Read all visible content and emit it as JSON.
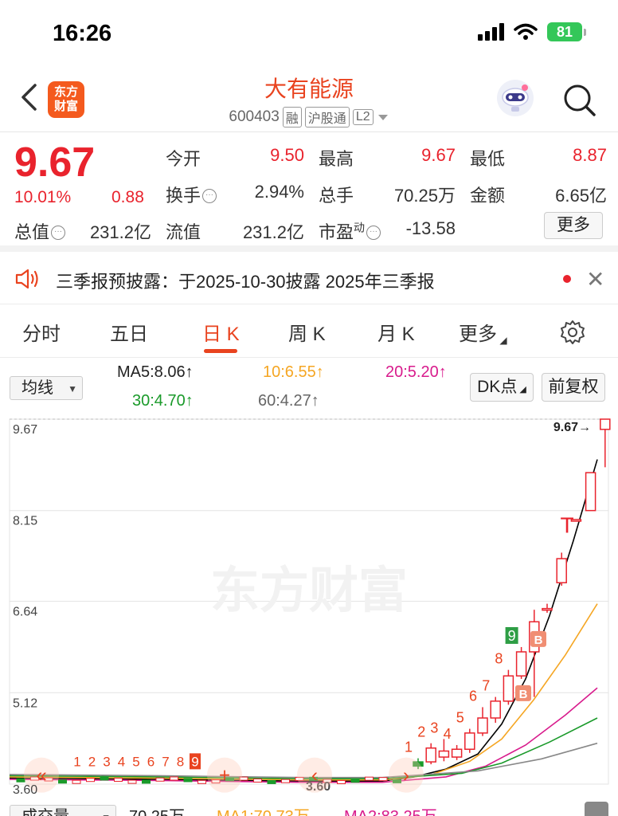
{
  "status": {
    "time": "16:26",
    "battery": "81"
  },
  "header": {
    "logo_line1": "东方",
    "logo_line2": "财富",
    "title": "大有能源",
    "code": "600403",
    "tags": [
      "融",
      "沪股通",
      "L2"
    ]
  },
  "quote": {
    "price": "9.67",
    "change_pct": "10.01%",
    "change_amt": "0.88",
    "fields": {
      "open_label": "今开",
      "open": "9.50",
      "high_label": "最高",
      "high": "9.67",
      "low_label": "最低",
      "low": "8.87",
      "turnover_label": "换手",
      "turnover": "2.94%",
      "volume_label": "总手",
      "volume": "70.25万",
      "amount_label": "金额",
      "amount": "6.65亿",
      "mktcap_label": "总值",
      "mktcap": "231.2亿",
      "float_label": "流值",
      "float": "231.2亿",
      "pe_label": "市盈",
      "pe_sup": "动",
      "pe": "-13.58"
    },
    "more_label": "更多"
  },
  "notice": {
    "text": "三季报预披露：于2025-10-30披露 2025年三季报"
  },
  "tabs": {
    "items": [
      "分时",
      "五日",
      "日 K",
      "周 K",
      "月 K",
      "更多"
    ],
    "active": "日 K"
  },
  "ma_legend": {
    "select": "均线",
    "ma5": "MA5:8.06↑",
    "ma10": "10:6.55↑",
    "ma20": "20:5.20↑",
    "ma30": "30:4.70↑",
    "ma60": "60:4.27↑",
    "dk_label": "DK点",
    "fq_label": "前复权",
    "colors": {
      "ma5": "#000000",
      "ma10": "#f5a623",
      "ma20": "#d81b8c",
      "ma30": "#1a9a2a",
      "ma60": "#888888"
    }
  },
  "chart_data": {
    "type": "candlestick",
    "y_ticks": [
      "9.67",
      "8.15",
      "6.64",
      "5.12",
      "3.60"
    ],
    "ylim": [
      3.6,
      9.67
    ],
    "last_price_label": "9.67→",
    "low_label": "3.60",
    "watermark": "东方财富",
    "signal_labels": [
      "1",
      "2",
      "3",
      "4",
      "5",
      "6",
      "7",
      "8",
      "9"
    ],
    "signal_labels_right": [
      "1",
      "2",
      "3",
      "4",
      "5",
      "6",
      "7",
      "8",
      "9"
    ],
    "b_marks": [
      "B",
      "B"
    ],
    "top_mark": "T",
    "candles": [
      {
        "o": 3.9,
        "c": 3.97,
        "h": 4.03,
        "l": 3.85
      },
      {
        "o": 3.97,
        "c": 4.2,
        "h": 4.28,
        "l": 3.93
      },
      {
        "o": 4.15,
        "c": 4.05,
        "h": 4.35,
        "l": 3.98
      },
      {
        "o": 4.05,
        "c": 4.18,
        "h": 4.25,
        "l": 4.0
      },
      {
        "o": 4.18,
        "c": 4.45,
        "h": 4.52,
        "l": 4.12
      },
      {
        "o": 4.45,
        "c": 4.7,
        "h": 4.88,
        "l": 4.4
      },
      {
        "o": 4.7,
        "c": 4.98,
        "h": 5.05,
        "l": 4.62
      },
      {
        "o": 4.98,
        "c": 5.4,
        "h": 5.5,
        "l": 4.92
      },
      {
        "o": 5.4,
        "c": 5.8,
        "h": 5.88,
        "l": 5.35
      },
      {
        "o": 5.8,
        "c": 6.3,
        "h": 6.5,
        "l": 5.05
      },
      {
        "o": 6.5,
        "c": 6.52,
        "h": 6.6,
        "l": 6.45
      },
      {
        "o": 6.95,
        "c": 7.35,
        "h": 7.45,
        "l": 6.9
      },
      {
        "o": 8.0,
        "c": 8.0,
        "h": 8.0,
        "l": 8.0
      },
      {
        "o": 8.15,
        "c": 8.78,
        "h": 8.78,
        "l": 8.15
      },
      {
        "o": 9.5,
        "c": 9.67,
        "h": 9.67,
        "l": 8.87
      }
    ]
  },
  "volume_row": {
    "select": "成交量",
    "vol": "70.25万",
    "ma1": "MA1:70.73万",
    "ma2": "MA2:83.25万"
  }
}
